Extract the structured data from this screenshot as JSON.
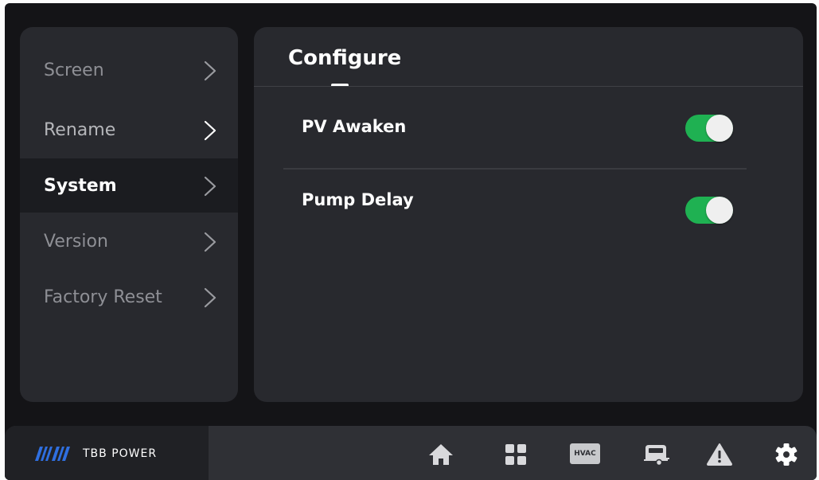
{
  "menu": {
    "items": [
      {
        "label": "Screen",
        "active": false
      },
      {
        "label": "Rename",
        "active": false
      },
      {
        "label": "System",
        "active": true
      },
      {
        "label": "Version",
        "active": false
      },
      {
        "label": "Factory Reset",
        "active": false
      }
    ]
  },
  "panel": {
    "title": "Configure",
    "settings": [
      {
        "label": "PV Awaken",
        "enabled": true
      },
      {
        "label": "Pump Delay",
        "enabled": true
      }
    ]
  },
  "bottom_bar": {
    "brand": "TBB POWER",
    "hvac_label": "HVAC",
    "icons": [
      "home-icon",
      "grid-icon",
      "hvac-icon",
      "rv-icon",
      "warning-icon",
      "gear-icon"
    ]
  },
  "colors": {
    "toggle_on": "#1fb152",
    "accent": "#2f6fe0",
    "panel_bg": "#28292e"
  }
}
